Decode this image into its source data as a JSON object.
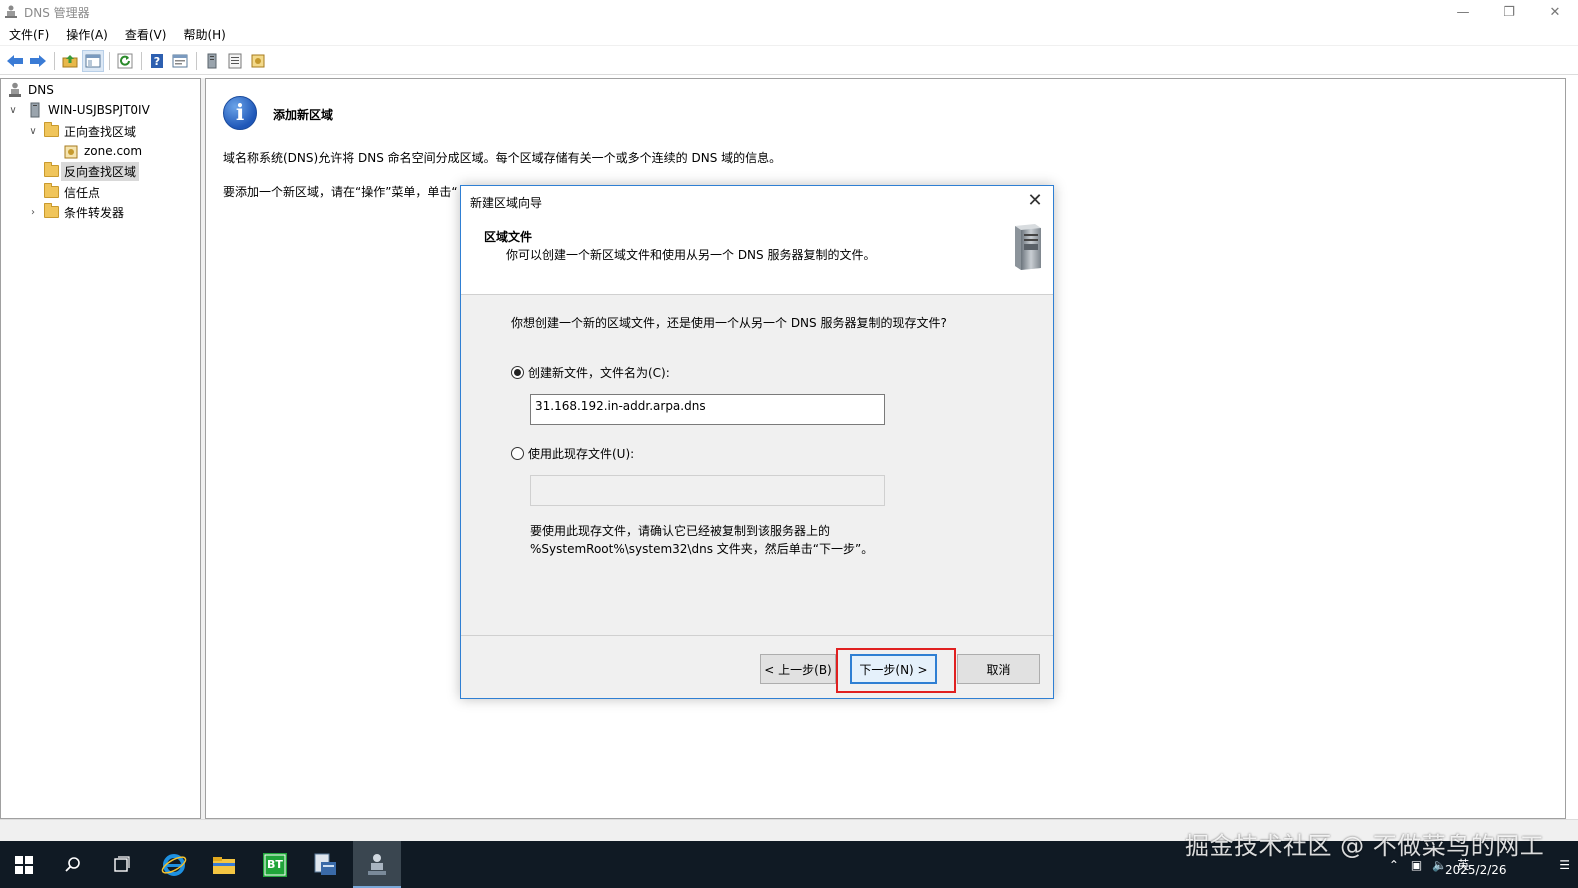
{
  "window": {
    "title": "DNS 管理器"
  },
  "menu": [
    "文件(F)",
    "操作(A)",
    "查看(V)",
    "帮助(H)"
  ],
  "tree": {
    "root": "DNS",
    "server": "WIN-USJBSPJT0IV",
    "forward_zones": "正向查找区域",
    "zone": "zone.com",
    "reverse_zones": "反向查找区域",
    "trust_points": "信任点",
    "conditional_forwarders": "条件转发器"
  },
  "main": {
    "heading": "添加新区域",
    "description": "域名称系统(DNS)允许将 DNS 命名空间分成区域。每个区域存储有关一个或多个连续的 DNS 域的信息。",
    "hint": "要添加一个新区域，请在“操作”菜单，单击“"
  },
  "dialog": {
    "title": "新建区域向导",
    "section_title": "区域文件",
    "section_desc": "你可以创建一个新区域文件和使用从另一个 DNS 服务器复制的文件。",
    "question": "你想创建一个新的区域文件，还是使用一个从另一个 DNS 服务器复制的现存文件?",
    "option_new_label": "创建新文件，文件名为(C):",
    "new_file_value": "31.168.192.in-addr.arpa.dns",
    "option_existing_label": "使用此现存文件(U):",
    "existing_file_value": "",
    "note_line1": "要使用此现存文件，请确认它已经被复制到该服务器上的",
    "note_line2": "%SystemRoot%\\system32\\dns 文件夹，然后单击“下一步”。",
    "back_button": "< 上一步(B)",
    "next_button": "下一步(N) >",
    "cancel_button": "取消"
  },
  "taskbar": {
    "bt_label": "BT",
    "tray_lang": "英",
    "date": "2025/2/26"
  },
  "watermark": "掘金技术社区 @ 不做菜鸟的网工"
}
